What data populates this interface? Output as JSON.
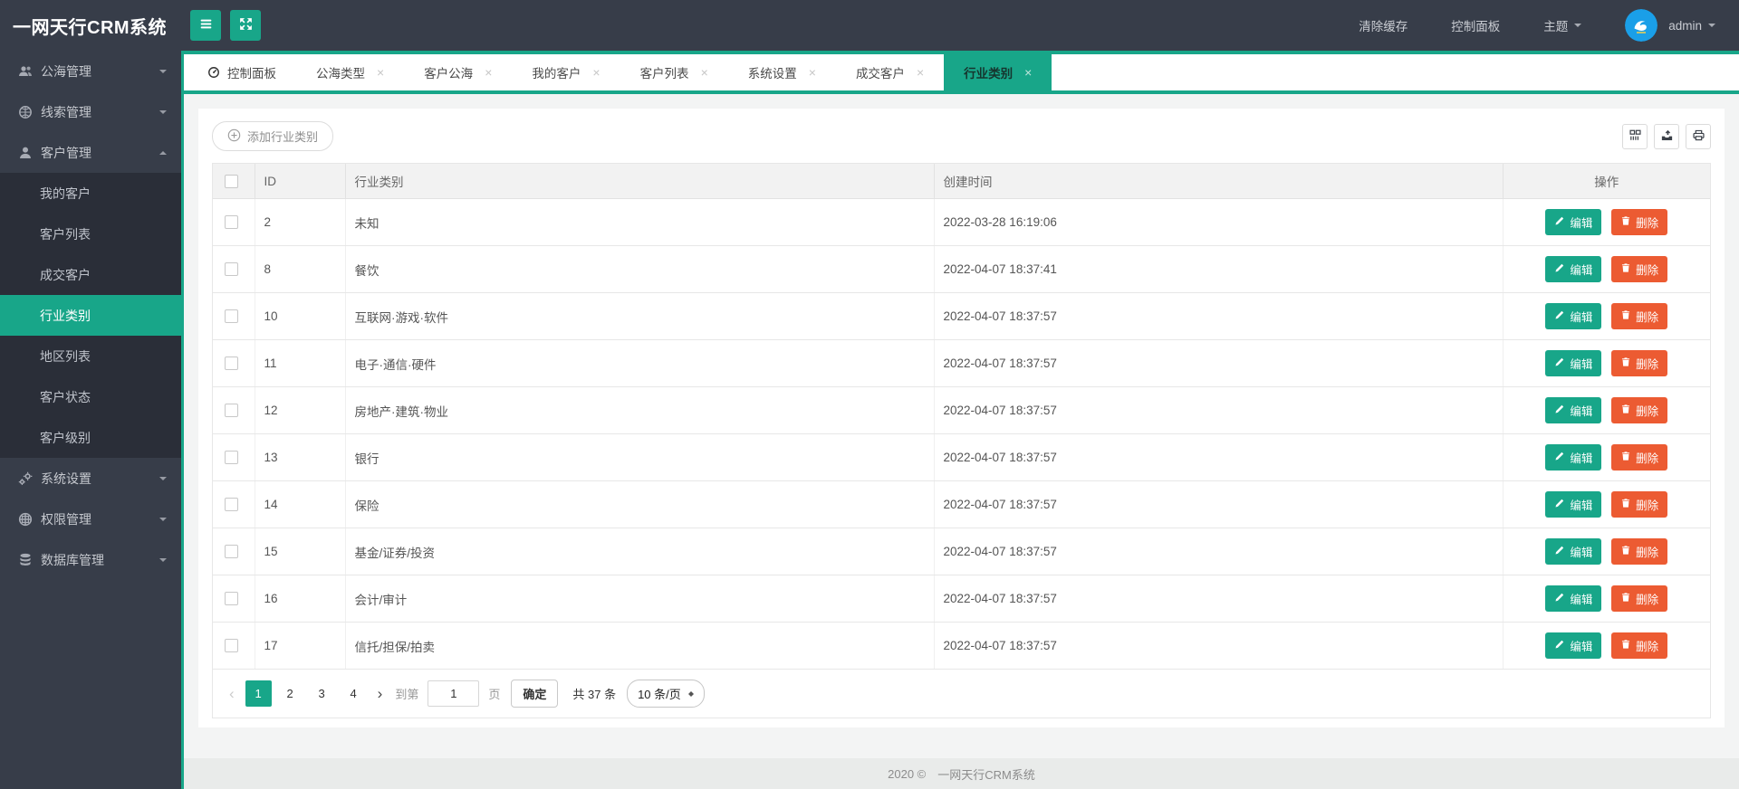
{
  "topbar": {
    "title": "一网天行CRM系统",
    "clear_cache": "清除缓存",
    "dashboard": "控制面板",
    "theme": "主题",
    "username": "admin",
    "icons": [
      "hamburger-icon",
      "fullscreen-expand-icon",
      "chevron-down-icon",
      "avatar-logo"
    ]
  },
  "sidebar": {
    "items": [
      {
        "label": "公海管理",
        "icon": "users",
        "parent": true,
        "caret": true
      },
      {
        "label": "线索管理",
        "icon": "globe",
        "parent": true,
        "caret": true
      },
      {
        "label": "客户管理",
        "icon": "user",
        "parent": true,
        "caret": true,
        "caret_up": true
      },
      {
        "label": "我的客户",
        "child": true
      },
      {
        "label": "客户列表",
        "child": true
      },
      {
        "label": "成交客户",
        "child": true
      },
      {
        "label": "行业类别",
        "child": true,
        "active": true
      },
      {
        "label": "地区列表",
        "child": true
      },
      {
        "label": "客户状态",
        "child": true
      },
      {
        "label": "客户级别",
        "child": true
      },
      {
        "label": "系统设置",
        "icon": "gears",
        "parent": true,
        "caret": true
      },
      {
        "label": "权限管理",
        "icon": "perm",
        "parent": true,
        "caret": true
      },
      {
        "label": "数据库管理",
        "icon": "database",
        "parent": true,
        "caret": true
      }
    ]
  },
  "tabs": [
    {
      "label": "控制面板",
      "icon": true
    },
    {
      "label": "公海类型",
      "closable": true
    },
    {
      "label": "客户公海",
      "closable": true
    },
    {
      "label": "我的客户",
      "closable": true
    },
    {
      "label": "客户列表",
      "closable": true
    },
    {
      "label": "系统设置",
      "closable": true
    },
    {
      "label": "成交客户",
      "closable": true
    },
    {
      "label": "行业类别",
      "closable": true,
      "active": true
    }
  ],
  "toolbar": {
    "add_label": "添加行业类别",
    "icons": [
      "columns-icon",
      "export-icon",
      "print-icon"
    ]
  },
  "table": {
    "columns": {
      "id": "ID",
      "category": "行业类别",
      "created": "创建时间",
      "actions": "操作"
    },
    "edit_label": "编辑",
    "delete_label": "删除",
    "rows": [
      {
        "id": "2",
        "category": "未知",
        "created": "2022-03-28 16:19:06"
      },
      {
        "id": "8",
        "category": "餐饮",
        "created": "2022-04-07 18:37:41"
      },
      {
        "id": "10",
        "category": "互联网·游戏·软件",
        "created": "2022-04-07 18:37:57"
      },
      {
        "id": "11",
        "category": "电子·通信·硬件",
        "created": "2022-04-07 18:37:57"
      },
      {
        "id": "12",
        "category": "房地产·建筑·物业",
        "created": "2022-04-07 18:37:57"
      },
      {
        "id": "13",
        "category": "银行",
        "created": "2022-04-07 18:37:57"
      },
      {
        "id": "14",
        "category": "保险",
        "created": "2022-04-07 18:37:57"
      },
      {
        "id": "15",
        "category": "基金/证券/投资",
        "created": "2022-04-07 18:37:57"
      },
      {
        "id": "16",
        "category": "会计/审计",
        "created": "2022-04-07 18:37:57"
      },
      {
        "id": "17",
        "category": "信托/担保/拍卖",
        "created": "2022-04-07 18:37:57"
      }
    ]
  },
  "pagination": {
    "pages": [
      {
        "label": "1",
        "active": true
      },
      {
        "label": "2"
      },
      {
        "label": "3"
      },
      {
        "label": "4"
      }
    ],
    "goto_label": "到第",
    "goto_value": "1",
    "page_unit": "页",
    "confirm_label": "确定",
    "total_label": "共 37 条",
    "per_page": "10 条/页"
  },
  "footer": {
    "year": "2020 ©",
    "name": "一网天行CRM系统"
  },
  "ui": {
    "close_glyph": "×",
    "prev_glyph": "‹",
    "next_glyph": "›"
  },
  "colors": {
    "accent": "#18A689",
    "danger": "#EC5B32",
    "topbar": "#373D49",
    "submenu": "#2A2E38"
  }
}
